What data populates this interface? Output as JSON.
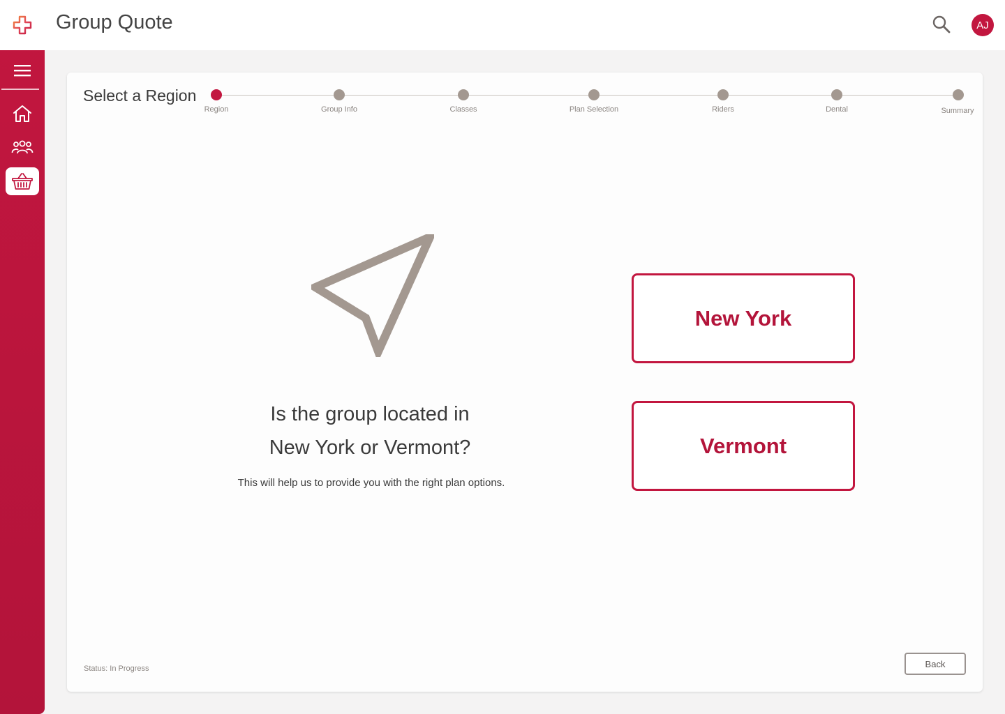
{
  "app": {
    "title": "Group Quote",
    "brand_color": "#c2163f",
    "avatar_initials": "AJ"
  },
  "sidebar": {
    "items": [
      {
        "name": "menu",
        "icon": "hamburger-icon"
      },
      {
        "name": "home",
        "icon": "home-icon"
      },
      {
        "name": "groups",
        "icon": "people-icon"
      },
      {
        "name": "quotes",
        "icon": "basket-icon",
        "active": true
      }
    ]
  },
  "stepper": {
    "title": "Select a Region",
    "steps": [
      {
        "label": "Region",
        "active": true
      },
      {
        "label": "Group Info",
        "active": false
      },
      {
        "label": "Classes",
        "active": false
      },
      {
        "label": "Plan Selection",
        "active": false
      },
      {
        "label": "Riders",
        "active": false
      },
      {
        "label": "Dental",
        "active": false
      },
      {
        "label": "Summary",
        "active": false
      }
    ]
  },
  "main": {
    "icon": "navigation-arrow-icon",
    "question_line1": "Is the group located in",
    "question_line2": "New York or Vermont?",
    "helper": "This will help us to provide you with the right plan options.",
    "options": [
      "New York",
      "Vermont"
    ]
  },
  "footer": {
    "status": "Status: In Progress",
    "back_label": "Back"
  }
}
